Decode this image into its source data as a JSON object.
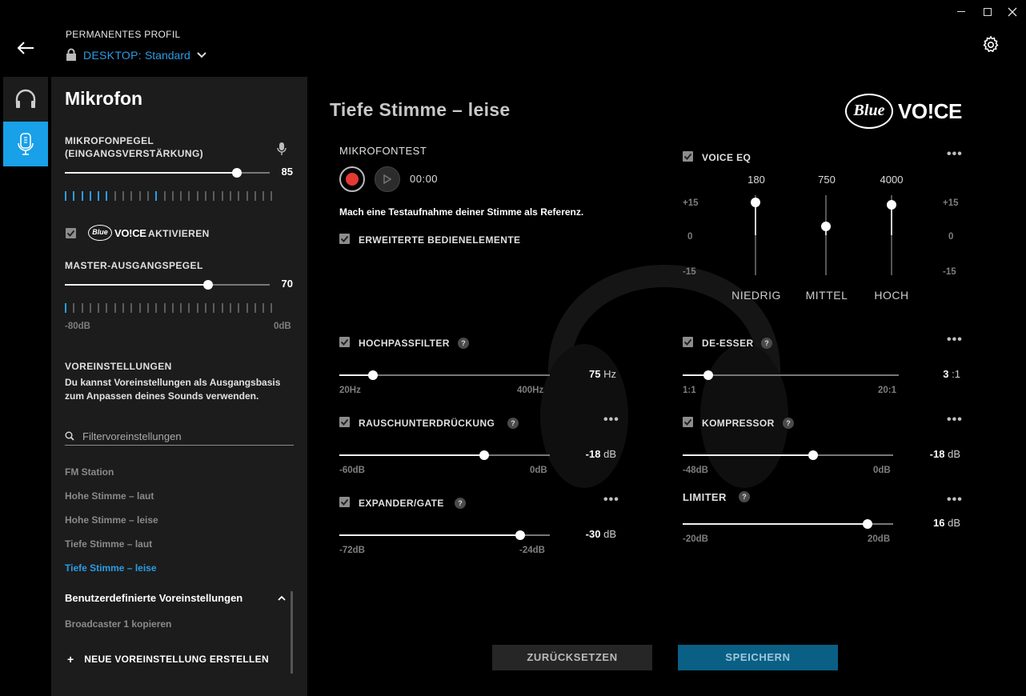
{
  "header": {
    "profile_label": "PERMANENTES PROFIL",
    "device_prefix": "DESKTOP:",
    "device_profile": "Standard"
  },
  "nav": {
    "headset": "headset-icon",
    "microphone": "microphone-icon"
  },
  "sidebar": {
    "title": "Mikrofon",
    "mic_level_label_1": "MIKROFONPEGEL",
    "mic_level_label_2": "(EINGANGSVERSTÄRKUNG)",
    "mic_level_value": "85",
    "mic_level": 0.85,
    "blue_voice_activate": "AKTIVIEREN",
    "master_label": "MASTER-AUSGANGSPEGEL",
    "master_value": "70",
    "master_level": 0.7,
    "master_min": "-80dB",
    "master_max": "0dB",
    "presets_title": "VOREINSTELLUNGEN",
    "presets_desc": "Du kannst Voreinstellungen als Ausgangsbasis zum Anpassen deines Sounds verwenden.",
    "filter_placeholder": "Filtervoreinstellungen",
    "presets": [
      "FM Station",
      "Hohe Stimme – laut",
      "Hohe Stimme – leise",
      "Tiefe Stimme – laut",
      "Tiefe Stimme – leise"
    ],
    "custom_title": "Benutzerdefinierte Voreinstellungen",
    "custom_items": [
      "Broadcaster 1 kopieren"
    ],
    "new_preset": "NEUE VOREINSTELLUNG ERSTELLEN"
  },
  "main": {
    "title": "Tiefe Stimme – leise",
    "mic_test": "MIKROFONTEST",
    "timer": "00:00",
    "test_hint": "Mach eine Testaufnahme deiner Stimme als Referenz.",
    "advanced": "ERWEITERTE BEDIENELEMENTE",
    "voice_eq": {
      "label": "VOICE EQ",
      "bands": [
        {
          "freq": "180",
          "name": "NIEDRIG",
          "level": 1.0
        },
        {
          "freq": "750",
          "name": "MITTEL",
          "level": 0.3
        },
        {
          "freq": "4000",
          "name": "HOCH",
          "level": 0.85
        }
      ],
      "scale_top": "+15",
      "scale_mid": "0",
      "scale_bot": "-15"
    },
    "highpass": {
      "label": "HOCHPASSFILTER",
      "value": "75",
      "unit": "Hz",
      "min": "20Hz",
      "max": "400Hz",
      "level": 0.16
    },
    "noise": {
      "label": "RAUSCHUNTERDRÜCKUNG",
      "value": "-18",
      "unit": "dB",
      "min": "-60dB",
      "max": "0dB",
      "level": 0.69
    },
    "expander": {
      "label": "EXPANDER/GATE",
      "value": "-30",
      "unit": "dB",
      "min": "-72dB",
      "max": "-24dB",
      "level": 0.86
    },
    "deesser": {
      "label": "DE-ESSER",
      "value": "3",
      "unit": ":1",
      "min": "1:1",
      "max": "20:1",
      "level": 0.12
    },
    "compressor": {
      "label": "KOMPRESSOR",
      "value": "-18",
      "unit": "dB",
      "min": "-48dB",
      "max": "0dB",
      "level": 0.6
    },
    "limiter": {
      "label": "LIMITER",
      "value": "16",
      "unit": "dB",
      "min": "-20dB",
      "max": "20dB",
      "level": 0.9
    },
    "reset": "ZURÜCKSETZEN",
    "save": "SPEICHERN",
    "logo_blue": "Blue",
    "logo_voice": "VO!CE"
  },
  "colors": {
    "accent": "#2b9ce6",
    "record": "#e53935",
    "save_bg": "#0a5f85"
  }
}
